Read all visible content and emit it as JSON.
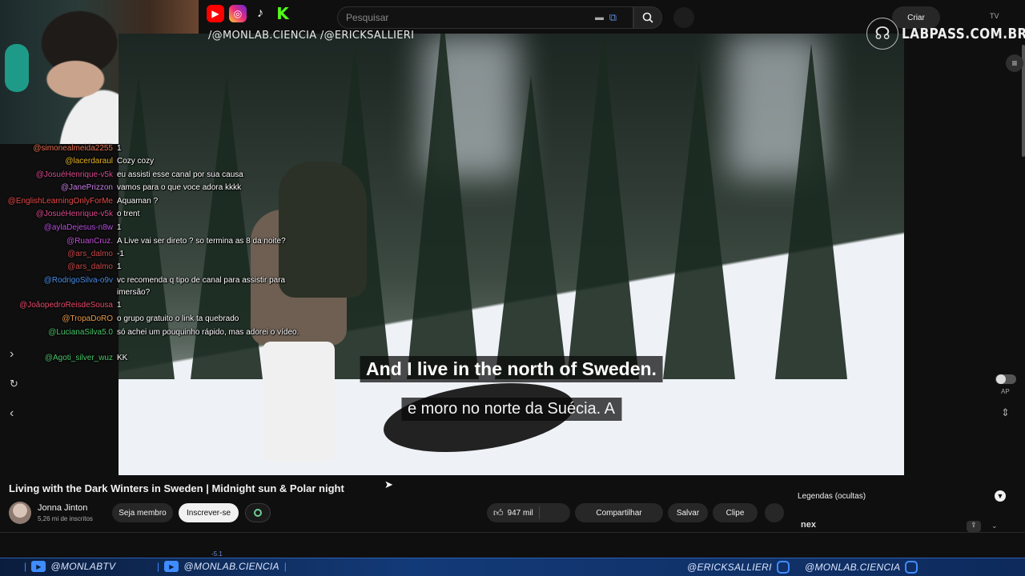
{
  "overlay": {
    "handles": "/@MONLAB.CIENCIA /@ERICKSALLIERI",
    "brand": "LABPASS.COM.BR"
  },
  "youtube": {
    "search_placeholder": "Pesquisar",
    "create_label": "Criar",
    "tv_label": "TV"
  },
  "chat": [
    {
      "user": "@simonealmeida2255",
      "text": "1",
      "color": "#e96f4f"
    },
    {
      "user": "@lacerdaraul",
      "text": "Cozy cozy",
      "color": "#e6b325"
    },
    {
      "user": "@JosuéHenrique-v5k",
      "text": "eu assisti esse canal por sua causa",
      "color": "#d94a8e"
    },
    {
      "user": "@JanePrizzon",
      "text": "vamos para o que voce adora kkkk",
      "color": "#c77de8"
    },
    {
      "user": "@EnglishLearningOnlyForMe",
      "text": "Aquaman ?",
      "color": "#e84a4a"
    },
    {
      "user": "@JosuéHenrique-v5k",
      "text": "o trent",
      "color": "#d94a8e"
    },
    {
      "user": "@aylaDejesus-n8w",
      "text": "1",
      "color": "#b74fe0"
    },
    {
      "user": "@RuanCruz.",
      "text": "A Live vai ser direto ? so termina as 8 da noite?",
      "color": "#c14fd8"
    },
    {
      "user": "@ars_dalmo",
      "text": "-1",
      "color": "#c94a4a"
    },
    {
      "user": "@ars_dalmo",
      "text": "1",
      "color": "#c94a4a"
    },
    {
      "user": "@RodrigoSilva-o9v",
      "text": "vc recomenda q tipo de canal para assistir para imersão?",
      "color": "#4a8fe8"
    },
    {
      "user": "@JoãopedroReisdeSousa",
      "text": "1",
      "color": "#e84a6a"
    },
    {
      "user": "@TropaDoRO",
      "text": "o grupo gratuito o link ta quebrado",
      "color": "#e89a4a"
    },
    {
      "user": "@LucianaSilva5.0",
      "text": "só achei um pouquinho rápido, mas adorei o vídeo.",
      "color": "#4ac46a"
    },
    {
      "user": "@Agoti_silver_wuz",
      "text": "KK",
      "color": "#4ac46a"
    }
  ],
  "video": {
    "subtitle_en": "And I live in the north of Sweden.",
    "subtitle_pt": "e moro no norte da Suécia. A",
    "autoplay_label": "AP",
    "title": "Living with the Dark Winters in Sweden | Midnight sun & Polar night"
  },
  "channel": {
    "name": "Jonna Jinton",
    "subs": "5,26 mi de inscritos",
    "join_label": "Seja membro",
    "subscribe_label": "Inscrever-se"
  },
  "actions": {
    "likes": "947 mil",
    "share": "Compartilhar",
    "save": "Salvar",
    "clip": "Clipe"
  },
  "side_panel": {
    "captions_label": "Legendas (ocultas)",
    "ad_logo": "nex"
  },
  "misc": {
    "mini_text": "-5.1"
  },
  "ribbon": {
    "item1": "@MONLABTV",
    "item2": "@MONLAB.CIENCIA",
    "item3": "@ERICKSALLIERI",
    "item4": "@MONLAB.CIENCIA"
  },
  "colors": {
    "accent": "#3f8cff",
    "yt_red": "#ff0000",
    "kick_green": "#53fc18"
  }
}
